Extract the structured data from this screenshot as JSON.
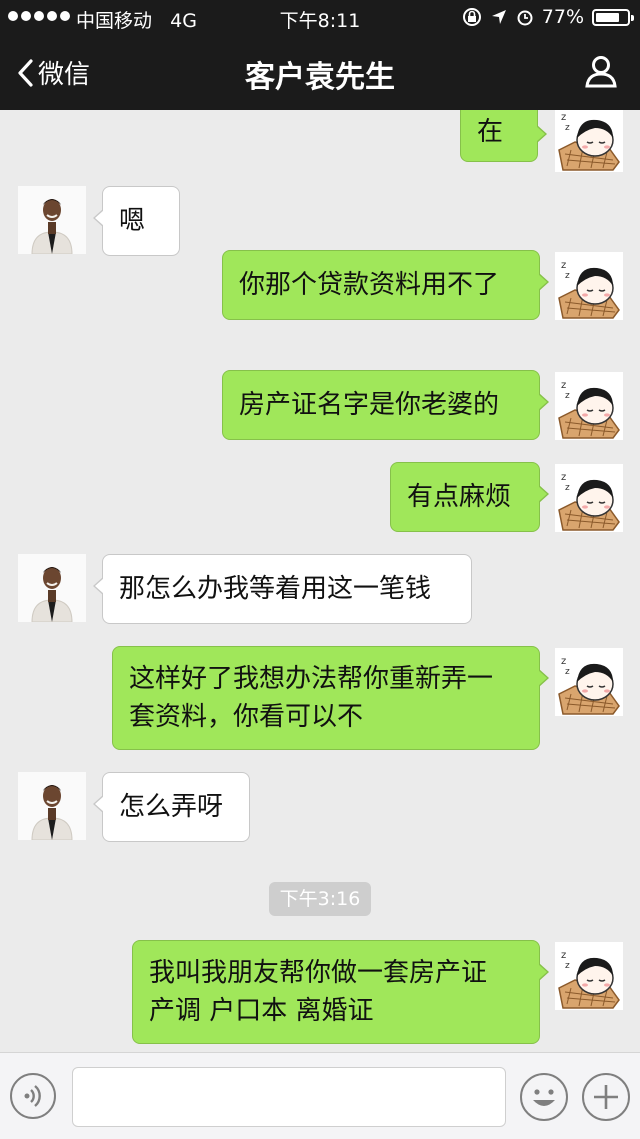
{
  "status_bar": {
    "carrier": "中国移动",
    "network": "4G",
    "time": "下午8:11",
    "battery": "77%",
    "battery_level": 0.77
  },
  "nav": {
    "back_label": "微信",
    "title": "客户袁先生"
  },
  "messages": [
    {
      "side": "right",
      "lines": [
        "在"
      ]
    },
    {
      "side": "left",
      "lines": [
        "嗯"
      ]
    },
    {
      "side": "right",
      "lines": [
        "你那个贷款资料用不了"
      ]
    },
    {
      "side": "right",
      "lines": [
        "房产证名字是你老婆的"
      ]
    },
    {
      "side": "right",
      "lines": [
        "有点麻烦"
      ]
    },
    {
      "side": "left",
      "lines": [
        "那怎么办我等着用这一笔钱"
      ]
    },
    {
      "side": "right",
      "lines": [
        "这样好了我想办法帮你重新弄一",
        "套资料，你看可以不"
      ]
    },
    {
      "side": "left",
      "lines": [
        "怎么弄呀"
      ]
    },
    {
      "side": "right",
      "lines": [
        "我叫我朋友帮你做一套房产证",
        "产调 户口本 离婚证"
      ]
    }
  ],
  "timestamp": "下午3:16",
  "icons": {
    "back": "chevron-left-icon",
    "user": "person-icon",
    "voice": "voice-icon",
    "emoji": "emoji-icon",
    "plus": "plus-icon"
  },
  "colors": {
    "header_bg": "#1b1b1b",
    "chat_bg": "#ebebeb",
    "sent_bubble": "#a0e75a",
    "received_bubble": "#ffffff"
  }
}
